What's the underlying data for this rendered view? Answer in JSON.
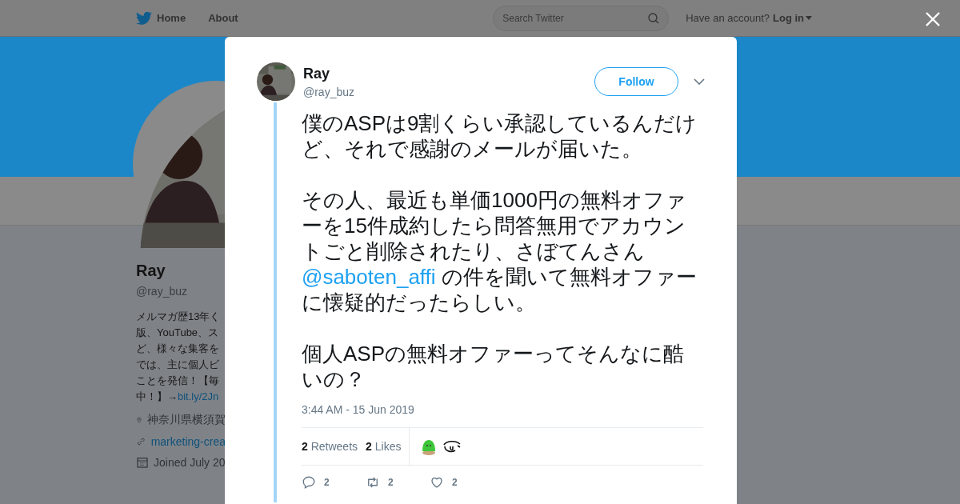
{
  "nav": {
    "items": [
      {
        "label": "Home"
      },
      {
        "label": "About"
      }
    ],
    "search": {
      "placeholder": "Search Twitter"
    },
    "account_prompt": "Have an account?",
    "login": "Log in"
  },
  "profile": {
    "name": "Ray",
    "handle": "@ray_buz",
    "bio_lines": [
      "メルマガ歴13年く",
      "版、YouTube、ス",
      "ど、様々な集客を",
      "では、主に個人ビ",
      "ことを発信！【毎"
    ],
    "bio_last": "中！】→",
    "bio_link": "bit.ly/2Jn",
    "location": "神奈川県横須賀",
    "website": "marketing-crea",
    "joined": "Joined July 20"
  },
  "tweet": {
    "name": "Ray",
    "handle": "@ray_buz",
    "follow": "Follow",
    "paragraphs": [
      [
        {
          "kind": "text",
          "text": "僕のASPは9割くらい承認しているんだけど、それで感謝のメールが届いた。"
        }
      ],
      [
        {
          "kind": "text",
          "text": "その人、最近も単価1000円の無料オファーを15件成約したら問答無用でアカウントごと削除されたり、さぼてんさん"
        },
        {
          "kind": "mention",
          "text": "@saboten_affi"
        },
        {
          "kind": "text",
          "text": " の件を聞いて無料オファーに懐疑的だったらしい。"
        }
      ],
      [
        {
          "kind": "text",
          "text": "個人ASPの無料オファーってそんなに酷いの？"
        }
      ]
    ],
    "time": "3:44 AM - 15 Jun 2019",
    "stats": [
      {
        "count": "2",
        "label": "Retweets"
      },
      {
        "count": "2",
        "label": "Likes"
      }
    ],
    "actions": [
      {
        "kind": "reply",
        "count": "2"
      },
      {
        "kind": "retweet",
        "count": "2"
      },
      {
        "kind": "like",
        "count": "2"
      }
    ]
  }
}
